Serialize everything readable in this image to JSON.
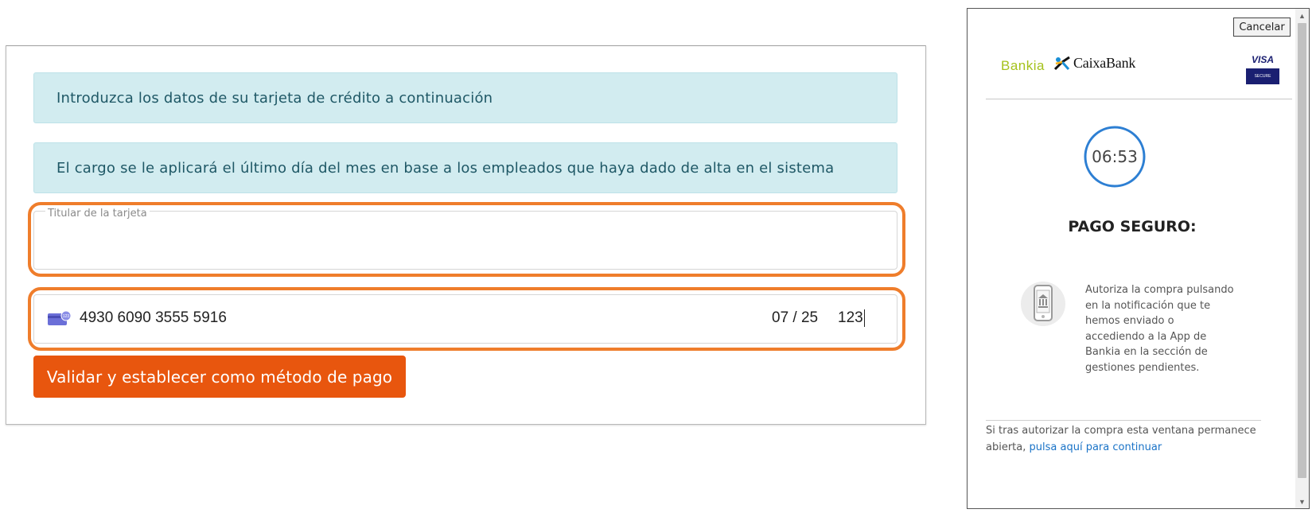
{
  "form": {
    "info_1": "Introduzca los datos de su tarjeta de crédito a continuación",
    "info_2": "El cargo se le aplicará el último día del mes en base a los empleados que haya dado de alta en el sistema",
    "holder_label": "Titular de la tarjeta",
    "holder_value": "",
    "card_number": "4930 6090 3555 5916",
    "card_expiry": "07 / 25",
    "card_cvc": "123",
    "validate_button": "Validar y establecer como método de pago",
    "colors": {
      "info_bg": "#d2ecf0",
      "highlight": "#ef7d2b",
      "button": "#e8560e"
    }
  },
  "popup": {
    "cancel_button": "Cancelar",
    "logo_bankia": "Bankia",
    "logo_caixabank": "CaixaBank",
    "visa_label": "VISA",
    "visa_secure_label": "SECURE",
    "timer": "06:53",
    "title": "PAGO SEGURO:",
    "auth_message": "Autoriza la compra pulsando en la notificación que te hemos enviado o accediendo a la App de Bankia en la sección de gestiones pendientes.",
    "footer_prefix": "Si tras autorizar la compra esta ventana permanece abierta,",
    "footer_link": "pulsa aquí para continuar",
    "icons": {
      "phone": "smartphone-bank-icon",
      "caixa_star": "caixabank-star-icon"
    },
    "colors": {
      "timer_ring": "#2d7fd3",
      "link": "#1a73c7",
      "bankia": "#a5c21c"
    }
  }
}
